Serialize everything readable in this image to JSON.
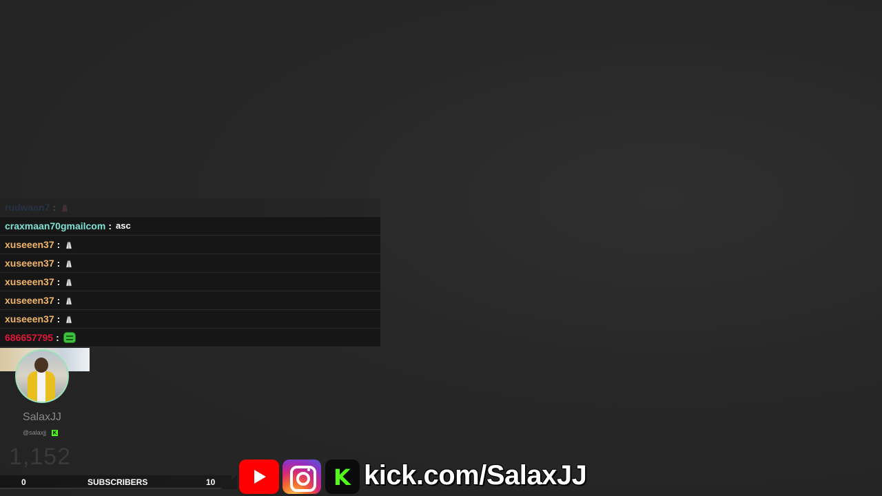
{
  "chat": {
    "messages": [
      {
        "user": "rudwaan7",
        "text": "",
        "emote": "heart-hands-emote",
        "color": "#2f63c8",
        "faded": true
      },
      {
        "user": "craxmaan70gmailcom",
        "text": "asc",
        "emote": "",
        "color": "#7fe3d3",
        "faded": false
      },
      {
        "user": "xuseeen37",
        "text": "",
        "emote": "praying-hands-emote",
        "color": "#f2b66b",
        "faded": false
      },
      {
        "user": "xuseeen37",
        "text": "",
        "emote": "praying-hands-emote",
        "color": "#f2b66b",
        "faded": false
      },
      {
        "user": "xuseeen37",
        "text": "",
        "emote": "praying-hands-emote",
        "color": "#f2b66b",
        "faded": false
      },
      {
        "user": "xuseeen37",
        "text": "",
        "emote": "praying-hands-emote",
        "color": "#f2b66b",
        "faded": false
      },
      {
        "user": "xuseeen37",
        "text": "",
        "emote": "praying-hands-emote",
        "color": "#f2b66b",
        "faded": false
      },
      {
        "user": "686657795",
        "text": "",
        "emote": "pepe-emote",
        "color": "#e0173a",
        "faded": false
      }
    ],
    "separator": ":"
  },
  "streamer": {
    "name": "SalaxJJ",
    "handle": "@salaxjj",
    "count": "1,152"
  },
  "subscribers": {
    "current": "0",
    "label": "SUBSCRIBERS",
    "goal": "10",
    "progress": 0
  },
  "socials": {
    "icons": [
      "youtube-icon",
      "instagram-icon",
      "kick-icon"
    ],
    "kick_letter": "K",
    "url": "kick.com/SalaxJJ"
  },
  "colors": {
    "kick_green": "#53fc18",
    "youtube_red": "#ff0000",
    "avatar_ring": "#9be3b9"
  }
}
